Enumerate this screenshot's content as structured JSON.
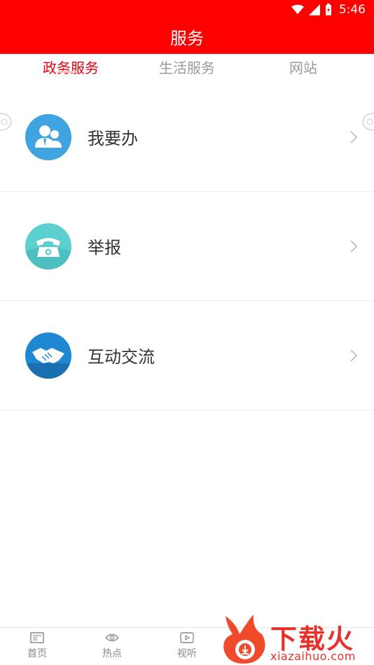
{
  "status_bar": {
    "time": "5:46",
    "icons": [
      "wifi-icon",
      "signal-icon",
      "battery-icon"
    ]
  },
  "header": {
    "title": "服务"
  },
  "tabs": [
    {
      "label": "政务服务",
      "active": true
    },
    {
      "label": "生活服务",
      "active": false
    },
    {
      "label": "网站",
      "active": false
    }
  ],
  "services": [
    {
      "label": "我要办",
      "icon": "user-icon",
      "color": "#3fa4e0"
    },
    {
      "label": "举报",
      "icon": "telephone-icon",
      "color": "#5ccfcf"
    },
    {
      "label": "互动交流",
      "icon": "handshake-icon",
      "color": "#1f88d3"
    }
  ],
  "bottom_nav": [
    {
      "label": "首页",
      "icon": "newspaper-icon"
    },
    {
      "label": "热点",
      "icon": "eye-icon"
    },
    {
      "label": "视听",
      "icon": "play-icon"
    }
  ],
  "watermark": {
    "text": "下载火",
    "url": "xiazaihuo.com"
  },
  "colors": {
    "brand_red": "#ff0000",
    "active_tab": "#e60012",
    "inactive_tab": "#9a9a9a"
  }
}
